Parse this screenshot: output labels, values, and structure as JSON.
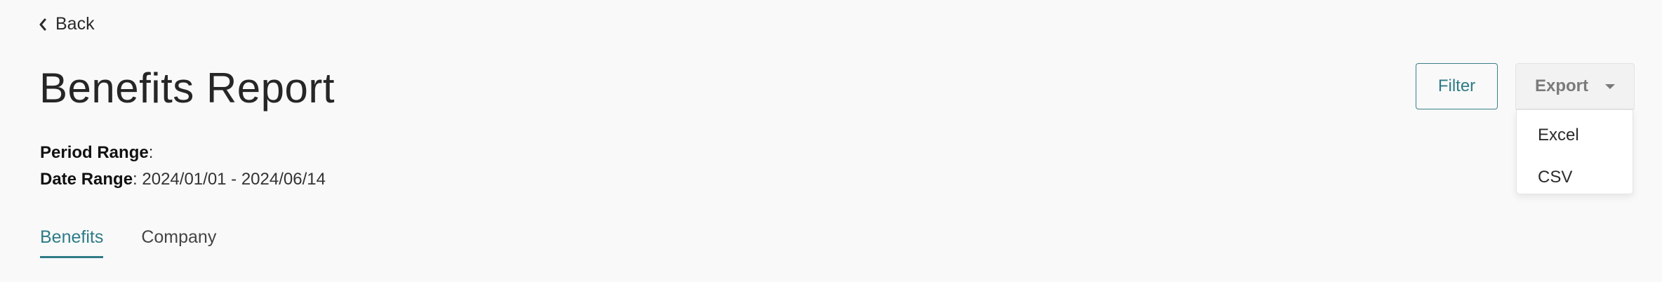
{
  "nav": {
    "back_label": "Back"
  },
  "header": {
    "title": "Benefits Report",
    "period_range_label": "Period Range",
    "period_range_value": "",
    "date_range_label": "Date Range",
    "date_range_value": "2024/01/01 - 2024/06/14"
  },
  "tabs": [
    {
      "label": "Benefits",
      "active": true
    },
    {
      "label": "Company",
      "active": false
    }
  ],
  "toolbar": {
    "filter_label": "Filter",
    "export_label": "Export",
    "export_options": [
      "Excel",
      "CSV"
    ]
  },
  "colors": {
    "accent": "#2e7b87",
    "background": "#f9f9f9"
  },
  "icons": {
    "back": "chevron-left-icon",
    "export": "caret-down-icon"
  }
}
